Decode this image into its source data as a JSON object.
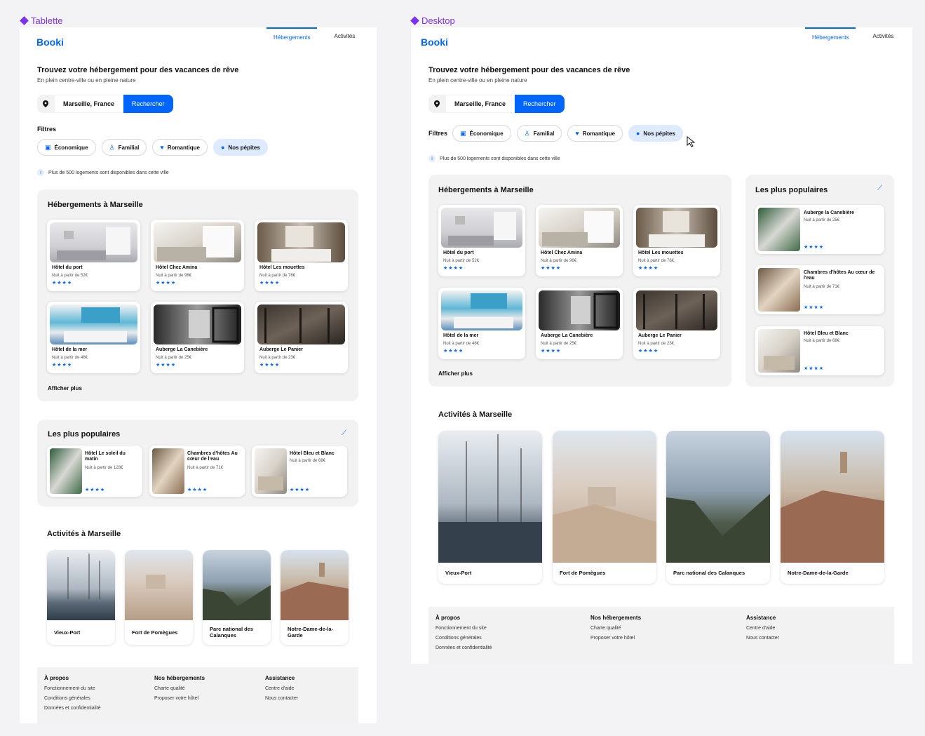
{
  "frames": {
    "tablet_label": "Tablette",
    "desktop_label": "Desktop"
  },
  "brand": "Booki",
  "nav": {
    "accommodations": "Hébergements",
    "activities": "Activités"
  },
  "hero": {
    "title": "Trouvez votre hébergement pour des vacances de rêve",
    "subtitle": "En plein centre-ville ou en pleine nature"
  },
  "search": {
    "location": "Marseille, France",
    "button": "Rechercher"
  },
  "filters": {
    "label": "Filtres",
    "items": [
      "Économique",
      "Familial",
      "Romantique",
      "Nos pépites"
    ],
    "active_index": 3
  },
  "info": "Plus de 500 logements sont disponibles dans cette ville",
  "accommodations": {
    "title": "Hébergements à Marseille",
    "items": [
      {
        "name": "Hôtel du port",
        "price": "Nuit à partir de 52€",
        "stars": "★★★★"
      },
      {
        "name": "Hôtel Chez Amina",
        "price": "Nuit à partir de 96€",
        "stars": "★★★★"
      },
      {
        "name": "Hôtel Les mouettes",
        "price": "Nuit à partir de 76€",
        "stars": "★★★★"
      },
      {
        "name": "Hôtel de la mer",
        "price": "Nuit à partir de 46€",
        "stars": "★★★★"
      },
      {
        "name": "Auberge La Canebière",
        "price": "Nuit à partir de 25€",
        "stars": "★★★★"
      },
      {
        "name": "Auberge Le Panier",
        "price": "Nuit à partir de 23€",
        "stars": "★★★★"
      }
    ],
    "more": "Afficher plus"
  },
  "popular_tablet": {
    "title": "Les plus populaires",
    "items": [
      {
        "name": "Hôtel Le soleil du matin",
        "price": "Nuit à partir de 128€",
        "stars": "★★★★"
      },
      {
        "name": "Chambres d'hôtes Au cœur de l'eau",
        "price": "Nuit à partir de 71€",
        "stars": "★★★★"
      },
      {
        "name": "Hôtel Bleu et Blanc",
        "price": "Nuit à partir de 68€",
        "stars": "★★★★"
      }
    ]
  },
  "popular_desktop": {
    "title": "Les plus populaires",
    "items": [
      {
        "name": "Auberge la Canebière",
        "price": "Nuit à partir de 25€",
        "stars": "★★★★"
      },
      {
        "name": "Chambres d'hôtes Au cœur de l'eau",
        "price": "Nuit à partir de 71€",
        "stars": "★★★★"
      },
      {
        "name": "Hôtel Bleu et Blanc",
        "price": "Nuit à partir de 68€",
        "stars": "★★★★"
      }
    ]
  },
  "activities": {
    "title": "Activités à Marseille",
    "items": [
      {
        "name": "Vieux-Port"
      },
      {
        "name": "Fort de Pomègues"
      },
      {
        "name": "Parc national des Calanques"
      },
      {
        "name": "Notre-Dame-de-la-Garde"
      }
    ]
  },
  "footer": {
    "about": {
      "title": "À propos",
      "links": [
        "Fonctionnement du site",
        "Conditions générales",
        "Données et confidentialité"
      ]
    },
    "hosting": {
      "title": "Nos hébergements",
      "links": [
        "Charte qualité",
        "Proposer votre hôtel"
      ]
    },
    "help": {
      "title": "Assistance",
      "links": [
        "Centre d'aide",
        "Nous contacter"
      ]
    }
  },
  "icons": {
    "pin": "location-pin-icon",
    "money": "money-icon",
    "family": "person-icon",
    "romance": "heart-icon",
    "gem": "sparkle-icon",
    "trend": "trending-icon"
  },
  "colors": {
    "primary": "#0065fc",
    "chip_active": "#deebff",
    "panel": "#f2f2f2",
    "frame_label": "#7b2ff7"
  }
}
